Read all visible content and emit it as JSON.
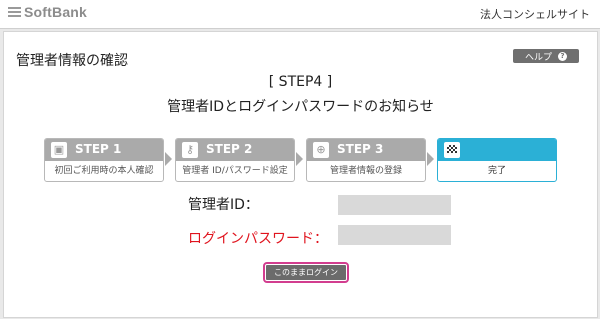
{
  "header": {
    "logo": "SoftBank",
    "site_name": "法人コンシェルサイト"
  },
  "page": {
    "title": "管理者情報の確認",
    "help_label": "ヘルプ",
    "help_icon": "?"
  },
  "heading": {
    "step": "[ STEP4 ]",
    "subtitle": "管理者IDとログインパスワードのお知らせ"
  },
  "steps": [
    {
      "label": "STEP 1",
      "caption": "初回ご利用時の本人確認",
      "icon": "user-card-icon"
    },
    {
      "label": "STEP 2",
      "caption": "管理者 ID/パスワード設定",
      "icon": "key-icon"
    },
    {
      "label": "STEP 3",
      "caption": "管理者情報の登録",
      "icon": "user-add-icon"
    },
    {
      "label": "",
      "caption": "完了",
      "icon": "checkered-flag-icon",
      "active": true
    }
  ],
  "fields": {
    "admin_id_label": "管理者ID：",
    "admin_id_value": "",
    "password_label": "ログインパスワード：",
    "password_value": ""
  },
  "actions": {
    "login_label": "このままログイン"
  },
  "colors": {
    "active_step": "#2bb0d6",
    "password_label": "#e0141e",
    "login_outline": "#d23d8f"
  }
}
